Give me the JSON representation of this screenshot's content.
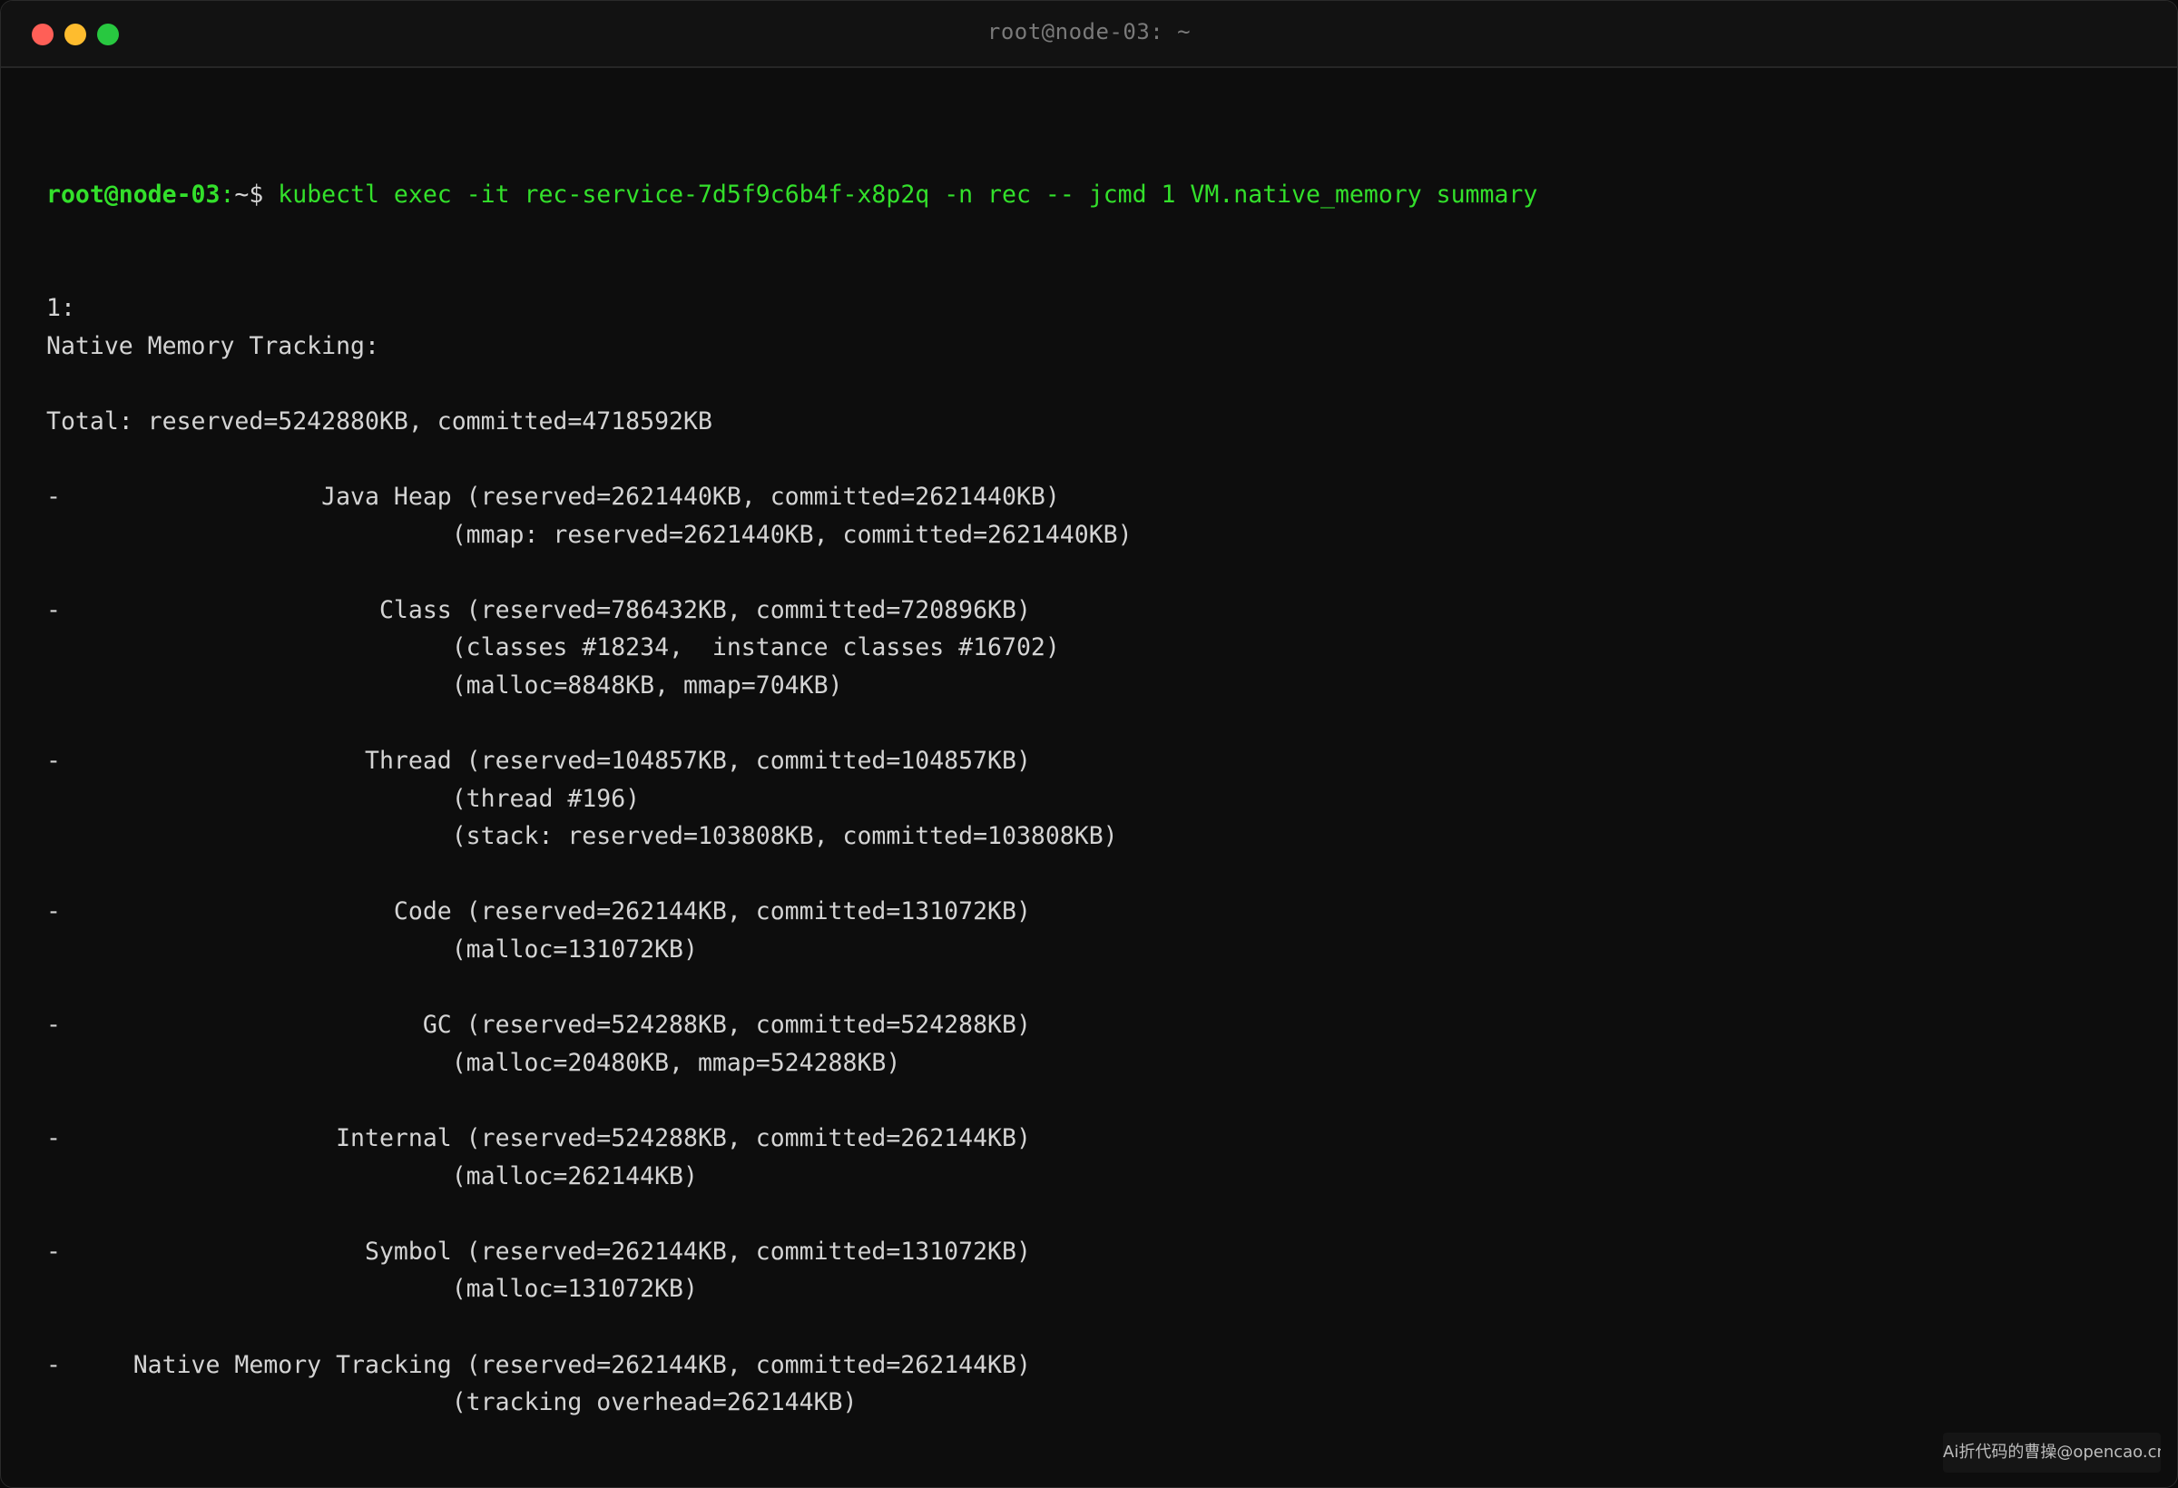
{
  "window": {
    "title": "root@node-03: ~"
  },
  "prompt": {
    "user_host": "root@node-03",
    "separator": ":",
    "path": "~$ ",
    "command": "kubectl exec -it rec-service-7d5f9c6b4f-x8p2q -n rec -- jcmd 1 VM.native_memory summary"
  },
  "output_lines": [
    "1:",
    "Native Memory Tracking:",
    "",
    "Total: reserved=5242880KB, committed=4718592KB",
    "",
    "-                  Java Heap (reserved=2621440KB, committed=2621440KB)",
    "                            (mmap: reserved=2621440KB, committed=2621440KB)",
    "",
    "-                      Class (reserved=786432KB, committed=720896KB)",
    "                            (classes #18234,  instance classes #16702)",
    "                            (malloc=8848KB, mmap=704KB)",
    "",
    "-                     Thread (reserved=104857KB, committed=104857KB)",
    "                            (thread #196)",
    "                            (stack: reserved=103808KB, committed=103808KB)",
    "",
    "-                       Code (reserved=262144KB, committed=131072KB)",
    "                            (malloc=131072KB)",
    "",
    "-                         GC (reserved=524288KB, committed=524288KB)",
    "                            (malloc=20480KB, mmap=524288KB)",
    "",
    "-                   Internal (reserved=524288KB, committed=262144KB)",
    "                            (malloc=262144KB)",
    "",
    "-                     Symbol (reserved=262144KB, committed=131072KB)",
    "                            (malloc=131072KB)",
    "",
    "-     Native Memory Tracking (reserved=262144KB, committed=262144KB)",
    "                            (tracking overhead=262144KB)"
  ],
  "watermark": {
    "text": "Ai折代码的曹操@opencao.cn"
  },
  "colors": {
    "background": "#0d0d0d",
    "prompt_green": "#33e02b",
    "output_text": "#d4d4d4",
    "close": "#ff5f57",
    "minimize": "#febc2e",
    "maximize": "#28c840"
  }
}
